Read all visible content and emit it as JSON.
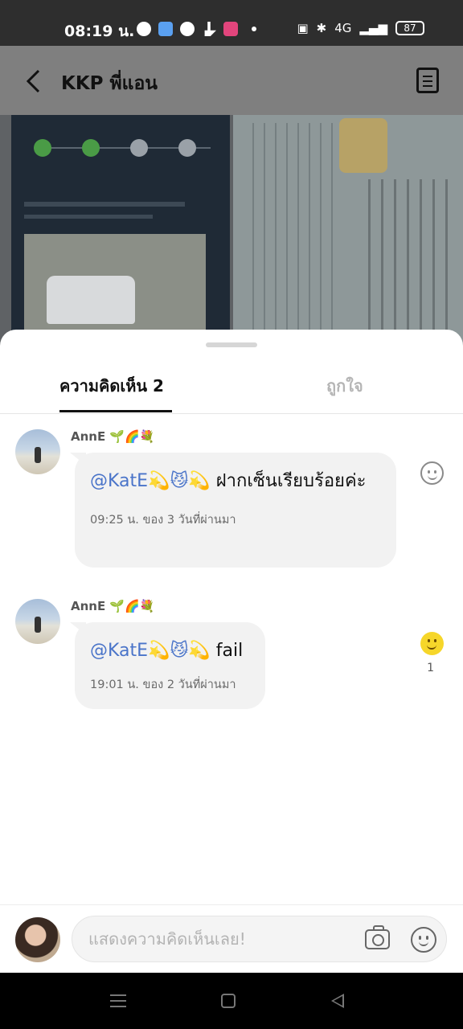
{
  "status_bar": {
    "time": "08:19 น.",
    "network": "4G",
    "battery": "87",
    "notification_icons": [
      "facebook-icon",
      "bluebird-app-icon",
      "line-icon",
      "tiktok-icon",
      "line-app-icon"
    ]
  },
  "header": {
    "title": "KKP พี่แอน"
  },
  "sheet": {
    "tabs": [
      {
        "label": "ความคิดเห็น 2",
        "active": true
      },
      {
        "label": "ถูกใจ",
        "active": false
      }
    ]
  },
  "comments": [
    {
      "author": "AnnE 🌱🌈💐",
      "mention": "@KatE💫😼💫",
      "text": " ฝากเซ็นเรียบร้อยค่ะ",
      "time": "09:25 น. ของ 3 วันที่ผ่านมา",
      "reaction_count": ""
    },
    {
      "author": "AnnE 🌱🌈💐",
      "mention": "@KatE💫😼💫",
      "text": " fail",
      "time": "19:01 น. ของ 2 วันที่ผ่านมา",
      "reaction_count": "1"
    }
  ],
  "input": {
    "placeholder": "แสดงความคิดเห็นเลย!"
  },
  "colors": {
    "mention": "#4a74c9",
    "reaction_active": "#f6d62a"
  }
}
